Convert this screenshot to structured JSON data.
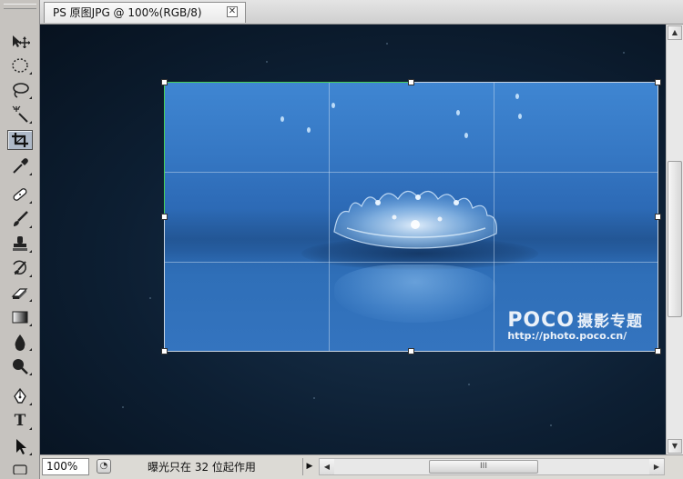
{
  "document": {
    "tab_title": "PS 原图JPG @ 100%(RGB/8)",
    "close_glyph": "✕"
  },
  "tools": [
    {
      "name": "move-tool-icon",
      "active": false
    },
    {
      "name": "marquee-tool-icon",
      "active": false
    },
    {
      "name": "lasso-tool-icon",
      "active": false
    },
    {
      "name": "magic-wand-tool-icon",
      "active": false
    },
    {
      "name": "crop-tool-icon",
      "active": true
    },
    {
      "name": "eyedropper-tool-icon",
      "active": false
    },
    {
      "name": "healing-brush-tool-icon",
      "active": false
    },
    {
      "name": "brush-tool-icon",
      "active": false
    },
    {
      "name": "clone-stamp-tool-icon",
      "active": false
    },
    {
      "name": "history-brush-tool-icon",
      "active": false
    },
    {
      "name": "eraser-tool-icon",
      "active": false
    },
    {
      "name": "gradient-tool-icon",
      "active": false
    },
    {
      "name": "blur-tool-icon",
      "active": false
    },
    {
      "name": "dodge-tool-icon",
      "active": false
    },
    {
      "name": "pen-tool-icon",
      "active": false
    },
    {
      "name": "type-tool-icon",
      "active": false
    },
    {
      "name": "path-selection-tool-icon",
      "active": false
    }
  ],
  "type_tool_glyph": "T",
  "watermark": {
    "brand": "POCO",
    "brand_cn": "摄影专题",
    "url": "http://photo.poco.cn/"
  },
  "statusbar": {
    "zoom": "100%",
    "info_text": "曝光只在 32 位起作用",
    "menu_arrow": "▶",
    "scroll_left": "◀",
    "scroll_right": "▶",
    "thumb_grip": "III"
  },
  "vscroll": {
    "up": "▲",
    "down": "▼"
  },
  "colors": {
    "crop_top_edge": "#48d05a",
    "photo_blue": "#3678c4",
    "canvas_dark": "#0d1f33"
  }
}
